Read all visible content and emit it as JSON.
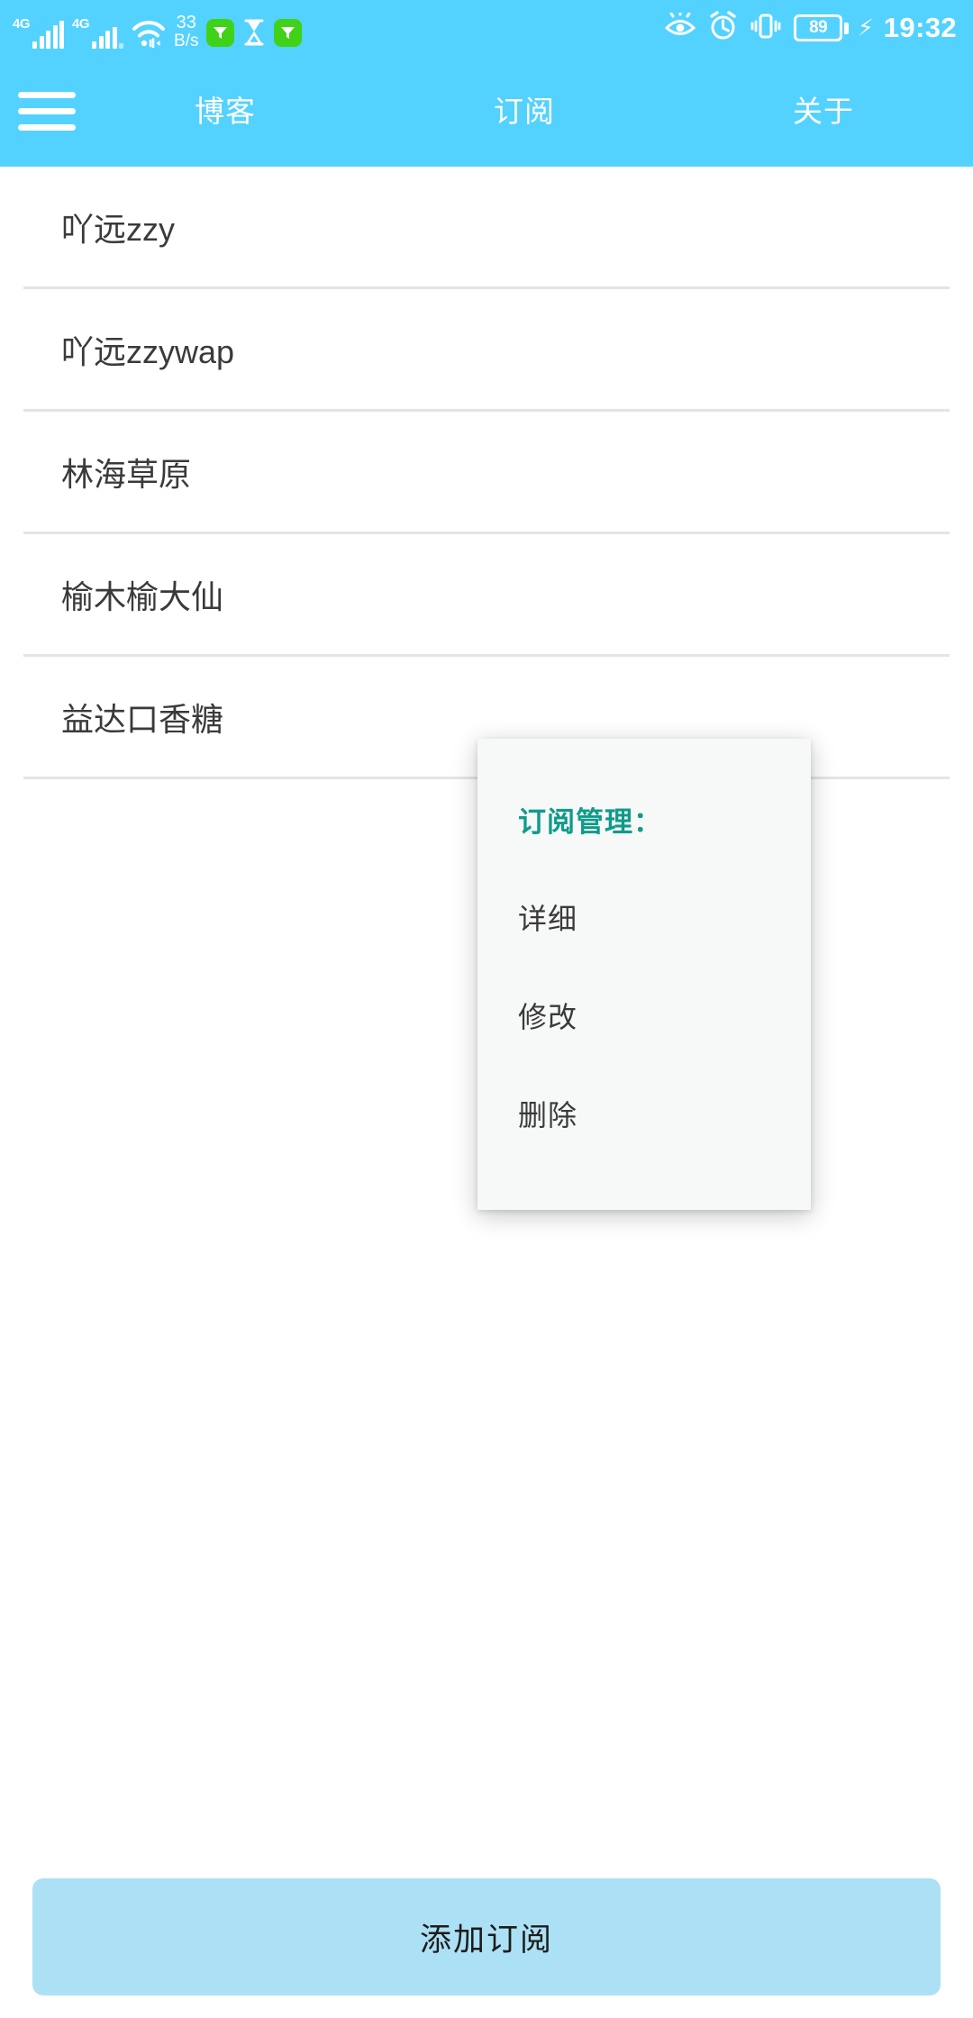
{
  "status_bar": {
    "signal_1_label": "4G",
    "signal_2_label": "4G",
    "wifi_icon": "wifi-icon",
    "network_speed_value": "33",
    "network_speed_unit": "B/s",
    "app_badge_1_icon": "green-app-icon",
    "hourglass_icon": "hourglass-icon",
    "app_badge_2_icon": "green-app-icon",
    "eye_comfort_icon": "eye-icon",
    "alarm_icon": "alarm-clock-icon",
    "vibrate_icon": "vibrate-icon",
    "battery_level": "89",
    "charging_icon": "lightning-bolt-icon",
    "time": "19:32"
  },
  "app_bar": {
    "menu_icon": "hamburger-menu-icon",
    "tabs": [
      {
        "label": "博客"
      },
      {
        "label": "订阅"
      },
      {
        "label": "关于"
      }
    ]
  },
  "list": {
    "items": [
      {
        "label": "吖远zzy"
      },
      {
        "label": "吖远zzywap"
      },
      {
        "label": "林海草原"
      },
      {
        "label": "榆木榆大仙"
      },
      {
        "label": "益达口香糖"
      }
    ]
  },
  "popup": {
    "title": "订阅管理：",
    "items": [
      {
        "label": "详细"
      },
      {
        "label": "修改"
      },
      {
        "label": "删除"
      }
    ]
  },
  "bottom": {
    "add_button_label": "添加订阅"
  },
  "colors": {
    "app_bar": "#53d2ff",
    "add_button": "#ace1f5",
    "popup_title": "#0e9b8a",
    "divider": "#e4e4e4",
    "list_text": "#3a3a3a"
  }
}
